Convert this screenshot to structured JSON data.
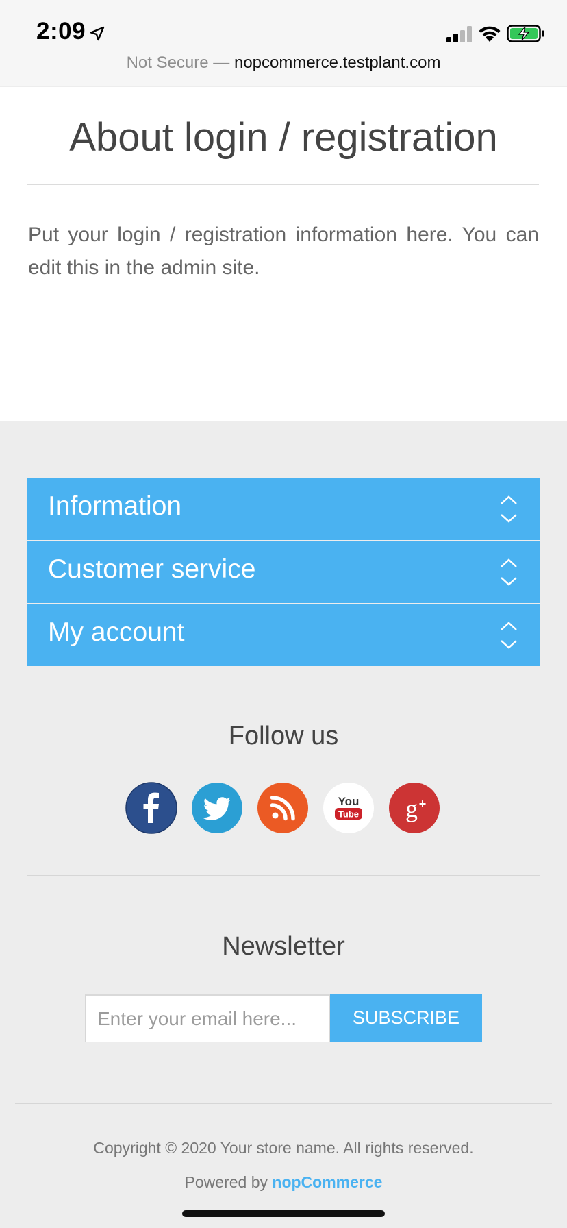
{
  "status_bar": {
    "time": "2:09",
    "location_icon": "location-arrow-icon",
    "signal_icon": "cellular-signal-icon",
    "wifi_icon": "wifi-icon",
    "battery_icon": "battery-charging-icon"
  },
  "browser": {
    "security": "Not Secure",
    "separator": " — ",
    "host": "nopcommerce.testplant.com"
  },
  "page": {
    "title": "About login / registration",
    "body": "Put your login / registration information here. You can edit this in the admin site."
  },
  "footer": {
    "accordion": [
      {
        "label": "Information"
      },
      {
        "label": "Customer service"
      },
      {
        "label": "My account"
      }
    ],
    "follow_title": "Follow us",
    "social": [
      {
        "name": "facebook-icon",
        "color": "#2c4f8d"
      },
      {
        "name": "twitter-icon",
        "color": "#2b9fd4"
      },
      {
        "name": "rss-icon",
        "color": "#eb5a24"
      },
      {
        "name": "youtube-icon",
        "color": "#ffffff"
      },
      {
        "name": "google-plus-icon",
        "color": "#cc3434"
      }
    ],
    "newsletter": {
      "title": "Newsletter",
      "placeholder": "Enter your email here...",
      "button": "SUBSCRIBE"
    },
    "copyright": "Copyright © 2020 Your store name. All rights reserved.",
    "powered_prefix": "Powered by ",
    "powered_link": "nopCommerce"
  },
  "colors": {
    "accent": "#4ab2f1",
    "footer_bg": "#ededed"
  }
}
